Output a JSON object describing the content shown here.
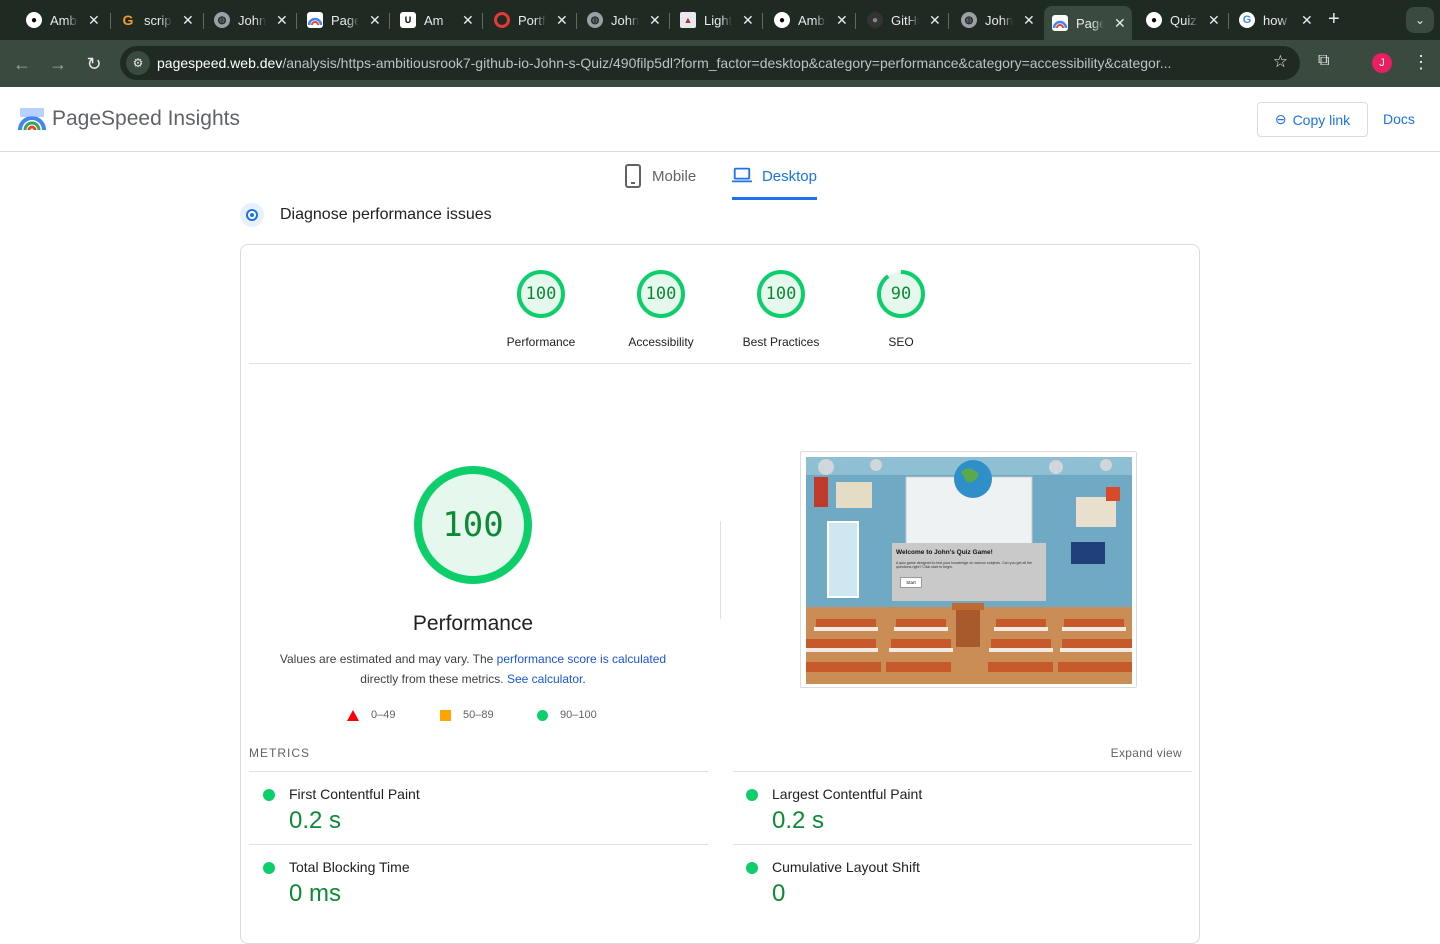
{
  "browser": {
    "tabs": [
      {
        "label": "Ambitious",
        "icon": "github-icon",
        "color": "#ffffff",
        "active": false
      },
      {
        "label": "scripts",
        "icon": "gitbook-icon",
        "color": "#f29a2e",
        "active": false
      },
      {
        "label": "John",
        "icon": "globe-icon",
        "color": "#9aa0a6",
        "active": false
      },
      {
        "label": "PageSpeed",
        "icon": "pagespeed-icon",
        "color": "#4285f4",
        "active": false
      },
      {
        "label": "Am",
        "icon": "udemy-icon",
        "color": "#ffffff",
        "active": false
      },
      {
        "label": "Portfolio",
        "icon": "opera-icon",
        "color": "#e53935",
        "active": false
      },
      {
        "label": "John",
        "icon": "globe-icon",
        "color": "#9aa0a6",
        "active": false
      },
      {
        "label": "Lighthouse",
        "icon": "lighthouse-icon",
        "color": "#e8eaed",
        "active": false
      },
      {
        "label": "Ambitious",
        "icon": "github-icon",
        "color": "#ffffff",
        "active": false
      },
      {
        "label": "GitHub",
        "icon": "github-dark-icon",
        "color": "#555555",
        "active": false
      },
      {
        "label": "John",
        "icon": "globe-icon",
        "color": "#9aa0a6",
        "active": false
      },
      {
        "label": "PageSpeed",
        "icon": "pagespeed-icon",
        "color": "#4285f4",
        "active": true
      },
      {
        "label": "Quiz",
        "icon": "github-icon",
        "color": "#ffffff",
        "active": false
      },
      {
        "label": "how",
        "icon": "google-icon",
        "color": "#4285f4",
        "active": false
      }
    ],
    "address": {
      "host": "pagespeed.web.dev",
      "path": "/analysis/https-ambitiousrook7-github-io-John-s-Quiz/490filp5dl?form_factor=desktop&category=performance&category=accessibility&categor..."
    },
    "profile_initial": "J"
  },
  "header": {
    "title": "PageSpeed Insights",
    "copy_link": "Copy link",
    "docs": "Docs"
  },
  "device_tabs": {
    "mobile": "Mobile",
    "desktop": "Desktop",
    "selected": "desktop"
  },
  "section": {
    "title": "Diagnose performance issues"
  },
  "scores": [
    {
      "label": "Performance",
      "value": 100
    },
    {
      "label": "Accessibility",
      "value": 100
    },
    {
      "label": "Best Practices",
      "value": 100
    },
    {
      "label": "SEO",
      "value": 90
    }
  ],
  "performance": {
    "score": 100,
    "label": "Performance",
    "note_prefix": "Values are estimated and may vary. The ",
    "note_link": "performance score is calculated",
    "note_middle": "directly from these metrics.",
    "note_link2": "See calculator",
    "note_suffix": "."
  },
  "legend": [
    {
      "range": "0–49",
      "shape": "triangle",
      "color": "#ff0000"
    },
    {
      "range": "50–89",
      "shape": "square",
      "color": "#ffa400"
    },
    {
      "range": "90–100",
      "shape": "circle",
      "color": "#0cce6b"
    }
  ],
  "screenshot": {
    "heading": "Welcome to John's Quiz Game!",
    "body": "A quiz game designed to test your knowledge on various subjects. Can you get all the questions right? Click start to begin.",
    "button": "Start"
  },
  "metrics": {
    "heading": "METRICS",
    "expand": "Expand view",
    "items": [
      {
        "name": "First Contentful Paint",
        "value": "0.2 s"
      },
      {
        "name": "Largest Contentful Paint",
        "value": "0.2 s"
      },
      {
        "name": "Total Blocking Time",
        "value": "0 ms"
      },
      {
        "name": "Cumulative Layout Shift",
        "value": "0"
      }
    ]
  },
  "colors": {
    "pass": "#0cce6b",
    "pass_text": "#0d8a34",
    "accent": "#1a73e8"
  }
}
